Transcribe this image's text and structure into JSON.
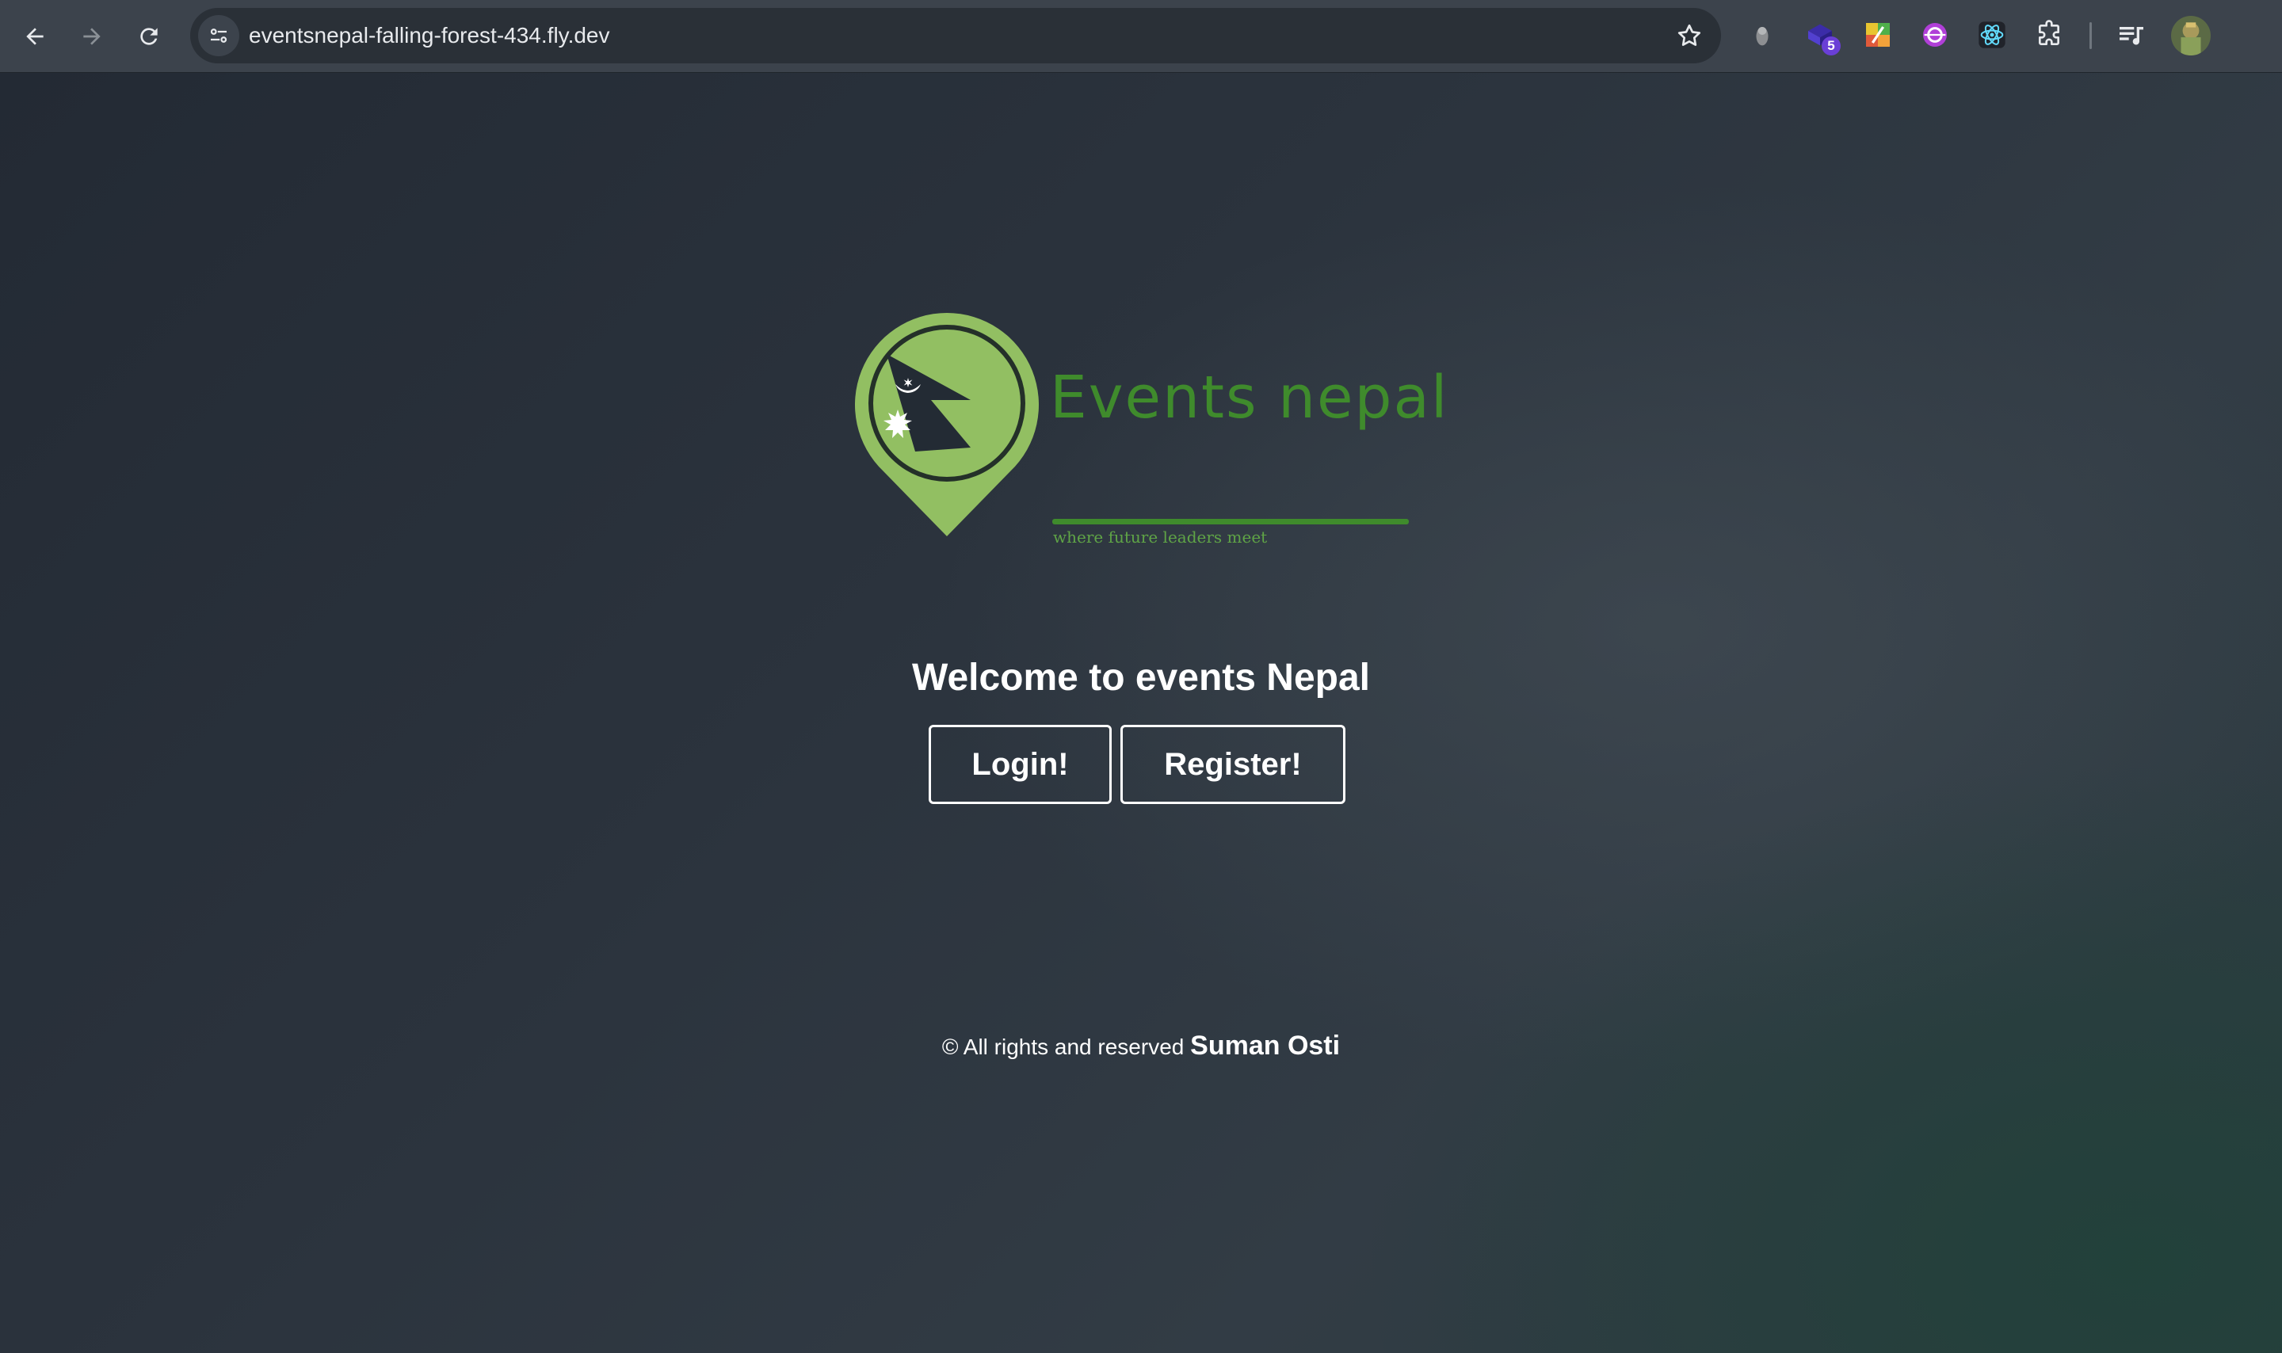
{
  "browser": {
    "url": "eventsnepal-falling-forest-434.fly.dev",
    "extensions": [
      {
        "icon": "puzzle-extension-icon"
      },
      {
        "icon": "stacked-boxes-extension-icon",
        "badge": "5"
      },
      {
        "icon": "colorful-grid-extension-icon"
      },
      {
        "icon": "purple-circle-extension-icon"
      },
      {
        "icon": "react-extension-icon"
      },
      {
        "icon": "extensions-puzzle-icon"
      }
    ]
  },
  "logo": {
    "title": "Events nepal",
    "tagline": "where future leaders meet"
  },
  "welcome": {
    "heading": "Welcome to events Nepal"
  },
  "buttons": {
    "login": "Login!",
    "register": "Register!"
  },
  "footer": {
    "text": "© All rights and reserved",
    "author": "Suman Osti"
  },
  "colors": {
    "brand_green": "#3f8b2c",
    "pin_green": "#92bf62",
    "background": "#2e3640"
  }
}
